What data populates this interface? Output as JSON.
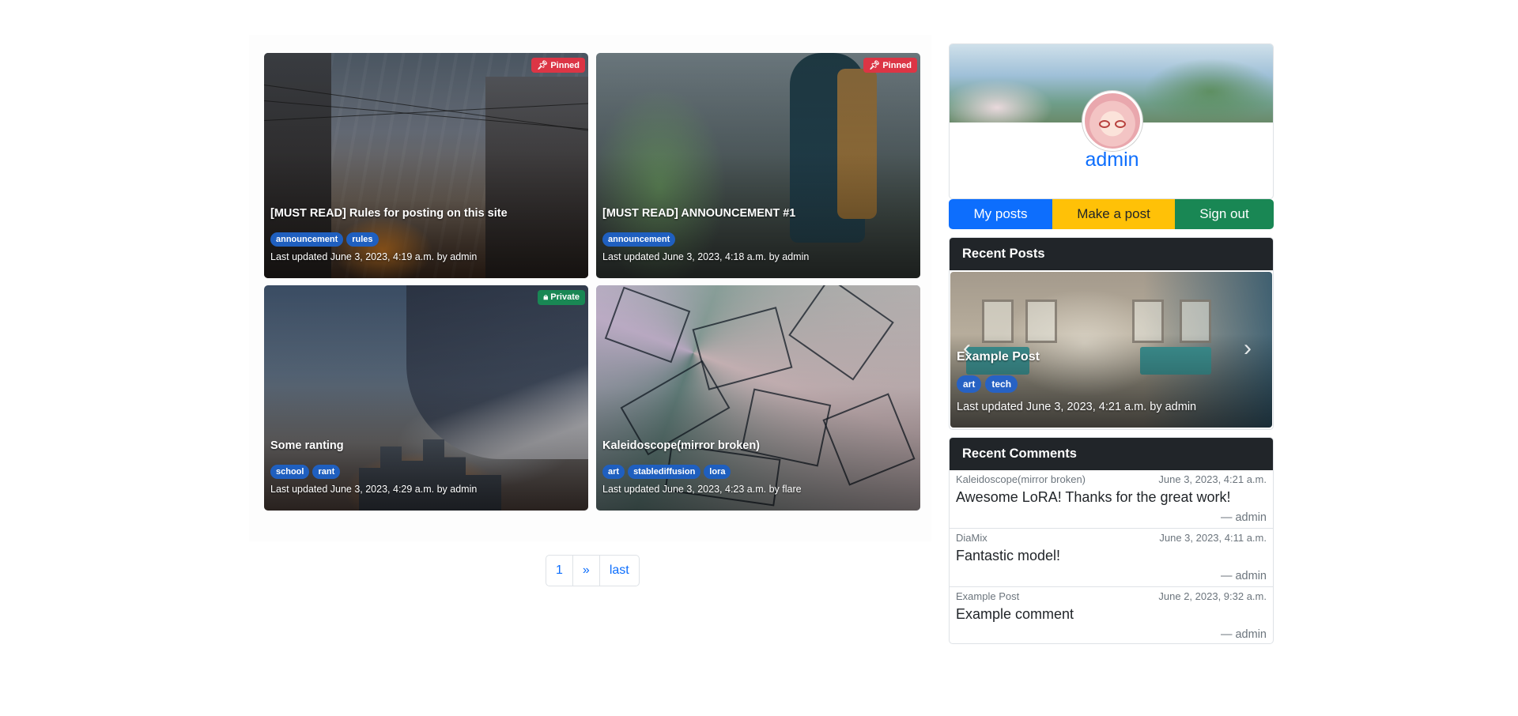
{
  "posts": [
    {
      "title": "[MUST READ] Rules for posting on this site",
      "status": "Pinned",
      "status_icon": "pin-icon",
      "tags": [
        "announcement",
        "rules"
      ],
      "meta": "Last updated June 3, 2023, 4:19 a.m. by admin"
    },
    {
      "title": "[MUST READ] ANNOUNCEMENT #1",
      "status": "Pinned",
      "status_icon": "pin-icon",
      "tags": [
        "announcement"
      ],
      "meta": "Last updated June 3, 2023, 4:18 a.m. by admin"
    },
    {
      "title": "Some ranting",
      "status": "Private",
      "status_icon": "lock-icon",
      "tags": [
        "school",
        "rant"
      ],
      "meta": "Last updated June 3, 2023, 4:29 a.m. by admin"
    },
    {
      "title": "Kaleidoscope(mirror broken)",
      "status": "",
      "tags": [
        "art",
        "stablediffusion",
        "lora"
      ],
      "meta": "Last updated June 3, 2023, 4:23 a.m. by flare"
    }
  ],
  "pagination": {
    "current": "1",
    "next": "»",
    "last": "last"
  },
  "profile": {
    "username": "admin",
    "buttons": {
      "my_posts": "My posts",
      "make_post": "Make a post",
      "sign_out": "Sign out"
    }
  },
  "recent_posts": {
    "header": "Recent Posts",
    "slide": {
      "title": "Example Post",
      "tags": [
        "art",
        "tech"
      ],
      "meta": "Last updated June 3, 2023, 4:21 a.m. by admin"
    }
  },
  "recent_comments": {
    "header": "Recent Comments",
    "items": [
      {
        "post": "Kaleidoscope(mirror broken)",
        "date": "June 3, 2023, 4:21 a.m.",
        "body": "Awesome LoRA! Thanks for the great work!",
        "author": "— admin"
      },
      {
        "post": "DiaMix",
        "date": "June 3, 2023, 4:11 a.m.",
        "body": "Fantastic model!",
        "author": "— admin"
      },
      {
        "post": "Example Post",
        "date": "June 2, 2023, 9:32 a.m.",
        "body": "Example comment",
        "author": "— admin"
      }
    ]
  },
  "colors": {
    "primary": "#0d6efd",
    "warning": "#ffc107",
    "success": "#198754",
    "danger": "#dc3545",
    "dark": "#212529"
  }
}
